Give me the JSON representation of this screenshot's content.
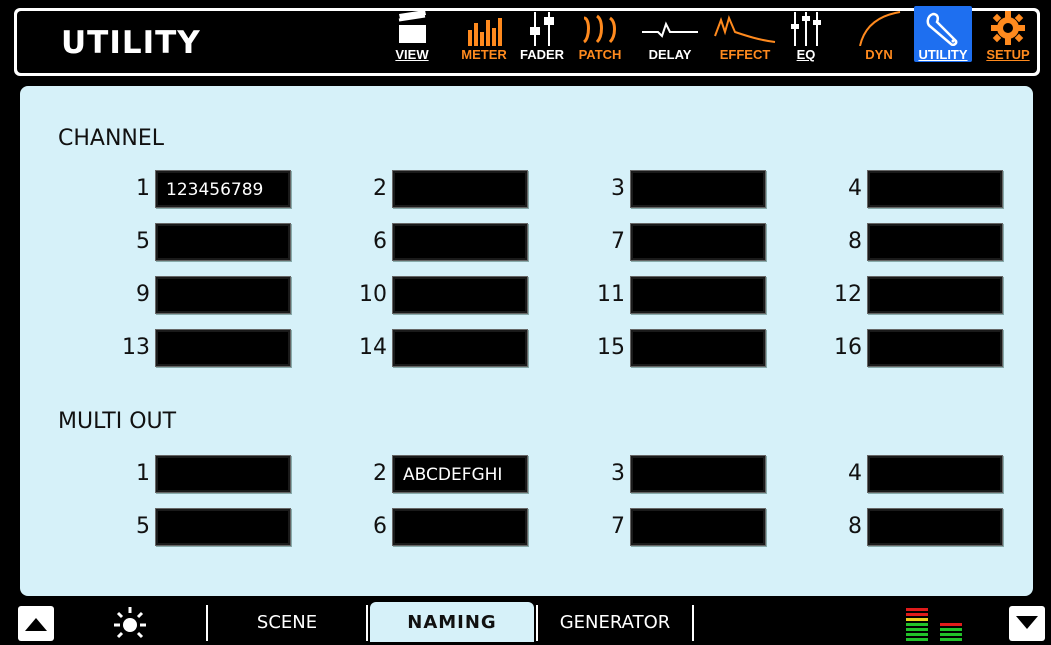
{
  "header": {
    "title": "UTILITY",
    "nav": [
      {
        "label": "VIEW",
        "icon": "clapperboard-icon",
        "color": "white"
      },
      {
        "label": "METER",
        "icon": "meter-bars-icon",
        "color": "orange"
      },
      {
        "label": "FADER",
        "icon": "fader-icon",
        "color": "white"
      },
      {
        "label": "PATCH",
        "icon": "patch-icon",
        "color": "orange"
      },
      {
        "label": "DELAY",
        "icon": "delay-wave-icon",
        "color": "white"
      },
      {
        "label": "EFFECT",
        "icon": "effect-wave-icon",
        "color": "orange"
      },
      {
        "label": "EQ",
        "icon": "eq-sliders-icon",
        "color": "white"
      },
      {
        "label": "DYN",
        "icon": "dyn-curve-icon",
        "color": "orange"
      },
      {
        "label": "UTILITY",
        "icon": "wrench-icon",
        "color": "white",
        "active": true
      },
      {
        "label": "SETUP",
        "icon": "gear-icon",
        "color": "orange"
      }
    ]
  },
  "channel": {
    "title": "CHANNEL",
    "slots": [
      {
        "num": "1",
        "name": "123456789"
      },
      {
        "num": "2",
        "name": ""
      },
      {
        "num": "3",
        "name": ""
      },
      {
        "num": "4",
        "name": ""
      },
      {
        "num": "5",
        "name": ""
      },
      {
        "num": "6",
        "name": ""
      },
      {
        "num": "7",
        "name": ""
      },
      {
        "num": "8",
        "name": ""
      },
      {
        "num": "9",
        "name": ""
      },
      {
        "num": "10",
        "name": ""
      },
      {
        "num": "11",
        "name": ""
      },
      {
        "num": "12",
        "name": ""
      },
      {
        "num": "13",
        "name": ""
      },
      {
        "num": "14",
        "name": ""
      },
      {
        "num": "15",
        "name": ""
      },
      {
        "num": "16",
        "name": ""
      }
    ]
  },
  "multi_out": {
    "title": "MULTI OUT",
    "slots": [
      {
        "num": "1",
        "name": ""
      },
      {
        "num": "2",
        "name": "ABCDEFGHI"
      },
      {
        "num": "3",
        "name": ""
      },
      {
        "num": "4",
        "name": ""
      },
      {
        "num": "5",
        "name": ""
      },
      {
        "num": "6",
        "name": ""
      },
      {
        "num": "7",
        "name": ""
      },
      {
        "num": "8",
        "name": ""
      }
    ]
  },
  "bottom": {
    "tabs": [
      {
        "label": "SCENE",
        "active": false
      },
      {
        "label": "NAMING",
        "active": true
      },
      {
        "label": "GENERATOR",
        "active": false
      }
    ],
    "icons": [
      "up-arrow-icon",
      "brightness-icon",
      "level-meter-icon",
      "down-arrow-icon"
    ]
  },
  "colors": {
    "panel_bg": "#d6f1f9",
    "accent_orange": "#ff8a1e",
    "active_blue": "#1e6ff0"
  }
}
